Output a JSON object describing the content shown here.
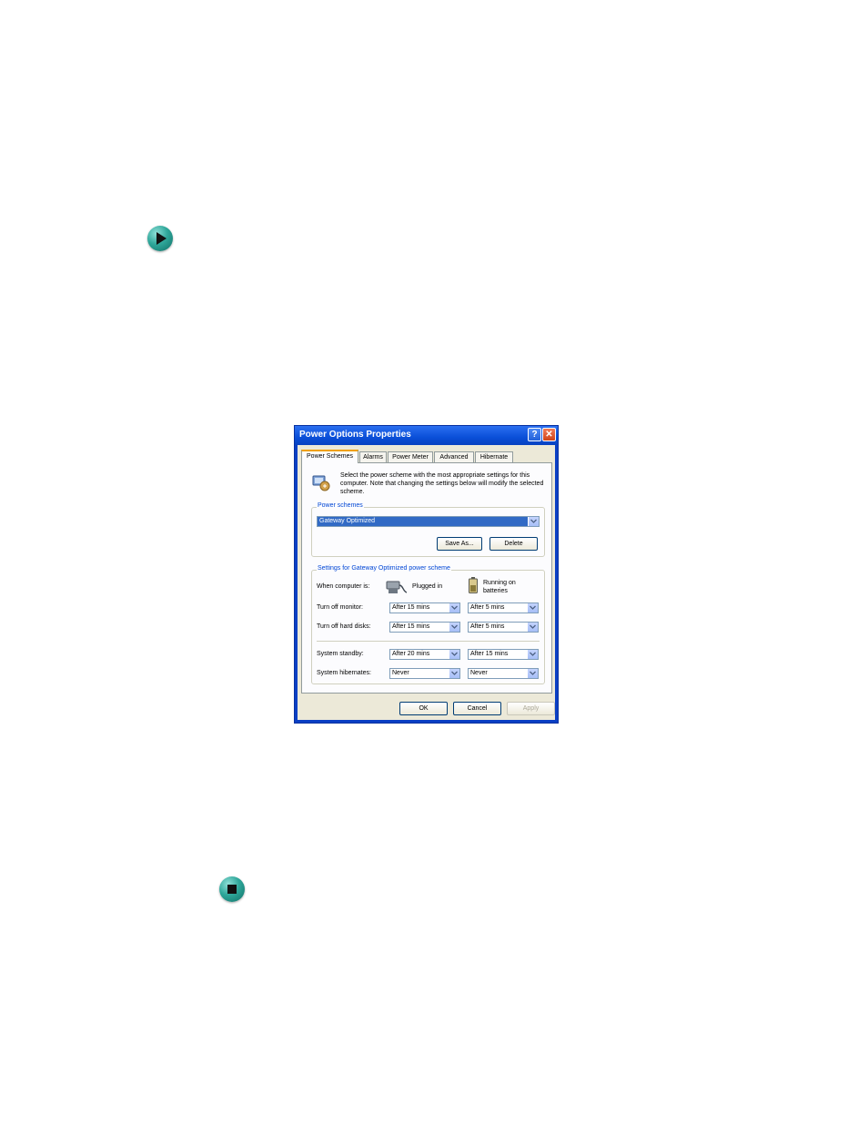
{
  "bullets": {
    "start_icon": "arrow-right-icon",
    "end_icon": "stop-square-icon",
    "color": "#2fa79a"
  },
  "dialog": {
    "title": "Power Options Properties",
    "help_glyph": "?",
    "close_glyph": "✕",
    "tabs": [
      "Power Schemes",
      "Alarms",
      "Power Meter",
      "Advanced",
      "Hibernate"
    ],
    "active_tab": "Power Schemes",
    "description": "Select the power scheme with the most appropriate settings for this computer. Note that changing the settings below will modify the selected scheme.",
    "power_schemes": {
      "label": "Power schemes",
      "selected": "Gateway Optimized",
      "save_as": "Save As...",
      "delete": "Delete"
    },
    "settings": {
      "label": "Settings for Gateway Optimized power scheme",
      "when_computer_is": "When computer is:",
      "plugged_in": "Plugged in",
      "running_on_batteries": "Running on batteries",
      "rows": [
        {
          "label": "Turn off monitor:",
          "plugged": "After 15 mins",
          "battery": "After 5 mins"
        },
        {
          "label": "Turn off hard disks:",
          "plugged": "After 15 mins",
          "battery": "After 5 mins"
        },
        {
          "label": "System standby:",
          "plugged": "After 20 mins",
          "battery": "After 15 mins"
        },
        {
          "label": "System hibernates:",
          "plugged": "Never",
          "battery": "Never"
        }
      ]
    },
    "buttons": {
      "ok": "OK",
      "cancel": "Cancel",
      "apply": "Apply"
    },
    "colors": {
      "titlebar": "#0a4fd8",
      "selection": "#316ac5",
      "group_label": "#0046d5"
    }
  }
}
